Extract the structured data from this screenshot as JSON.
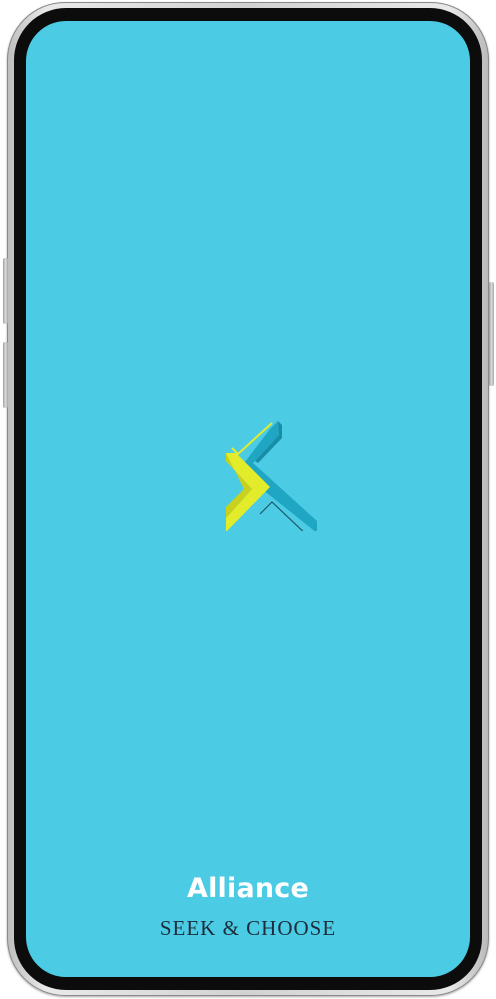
{
  "app": {
    "brand_name": "Alliance",
    "tagline": "SEEK & CHOOSE",
    "logo_icon": "alliance-x-logo-icon"
  },
  "colors": {
    "screen_background": "#4ccbe4",
    "logo_blue": "#1fa6c2",
    "logo_yellow": "#e3ec2a",
    "brand_text": "#ffffff",
    "tagline_text": "#1c2c3a"
  }
}
